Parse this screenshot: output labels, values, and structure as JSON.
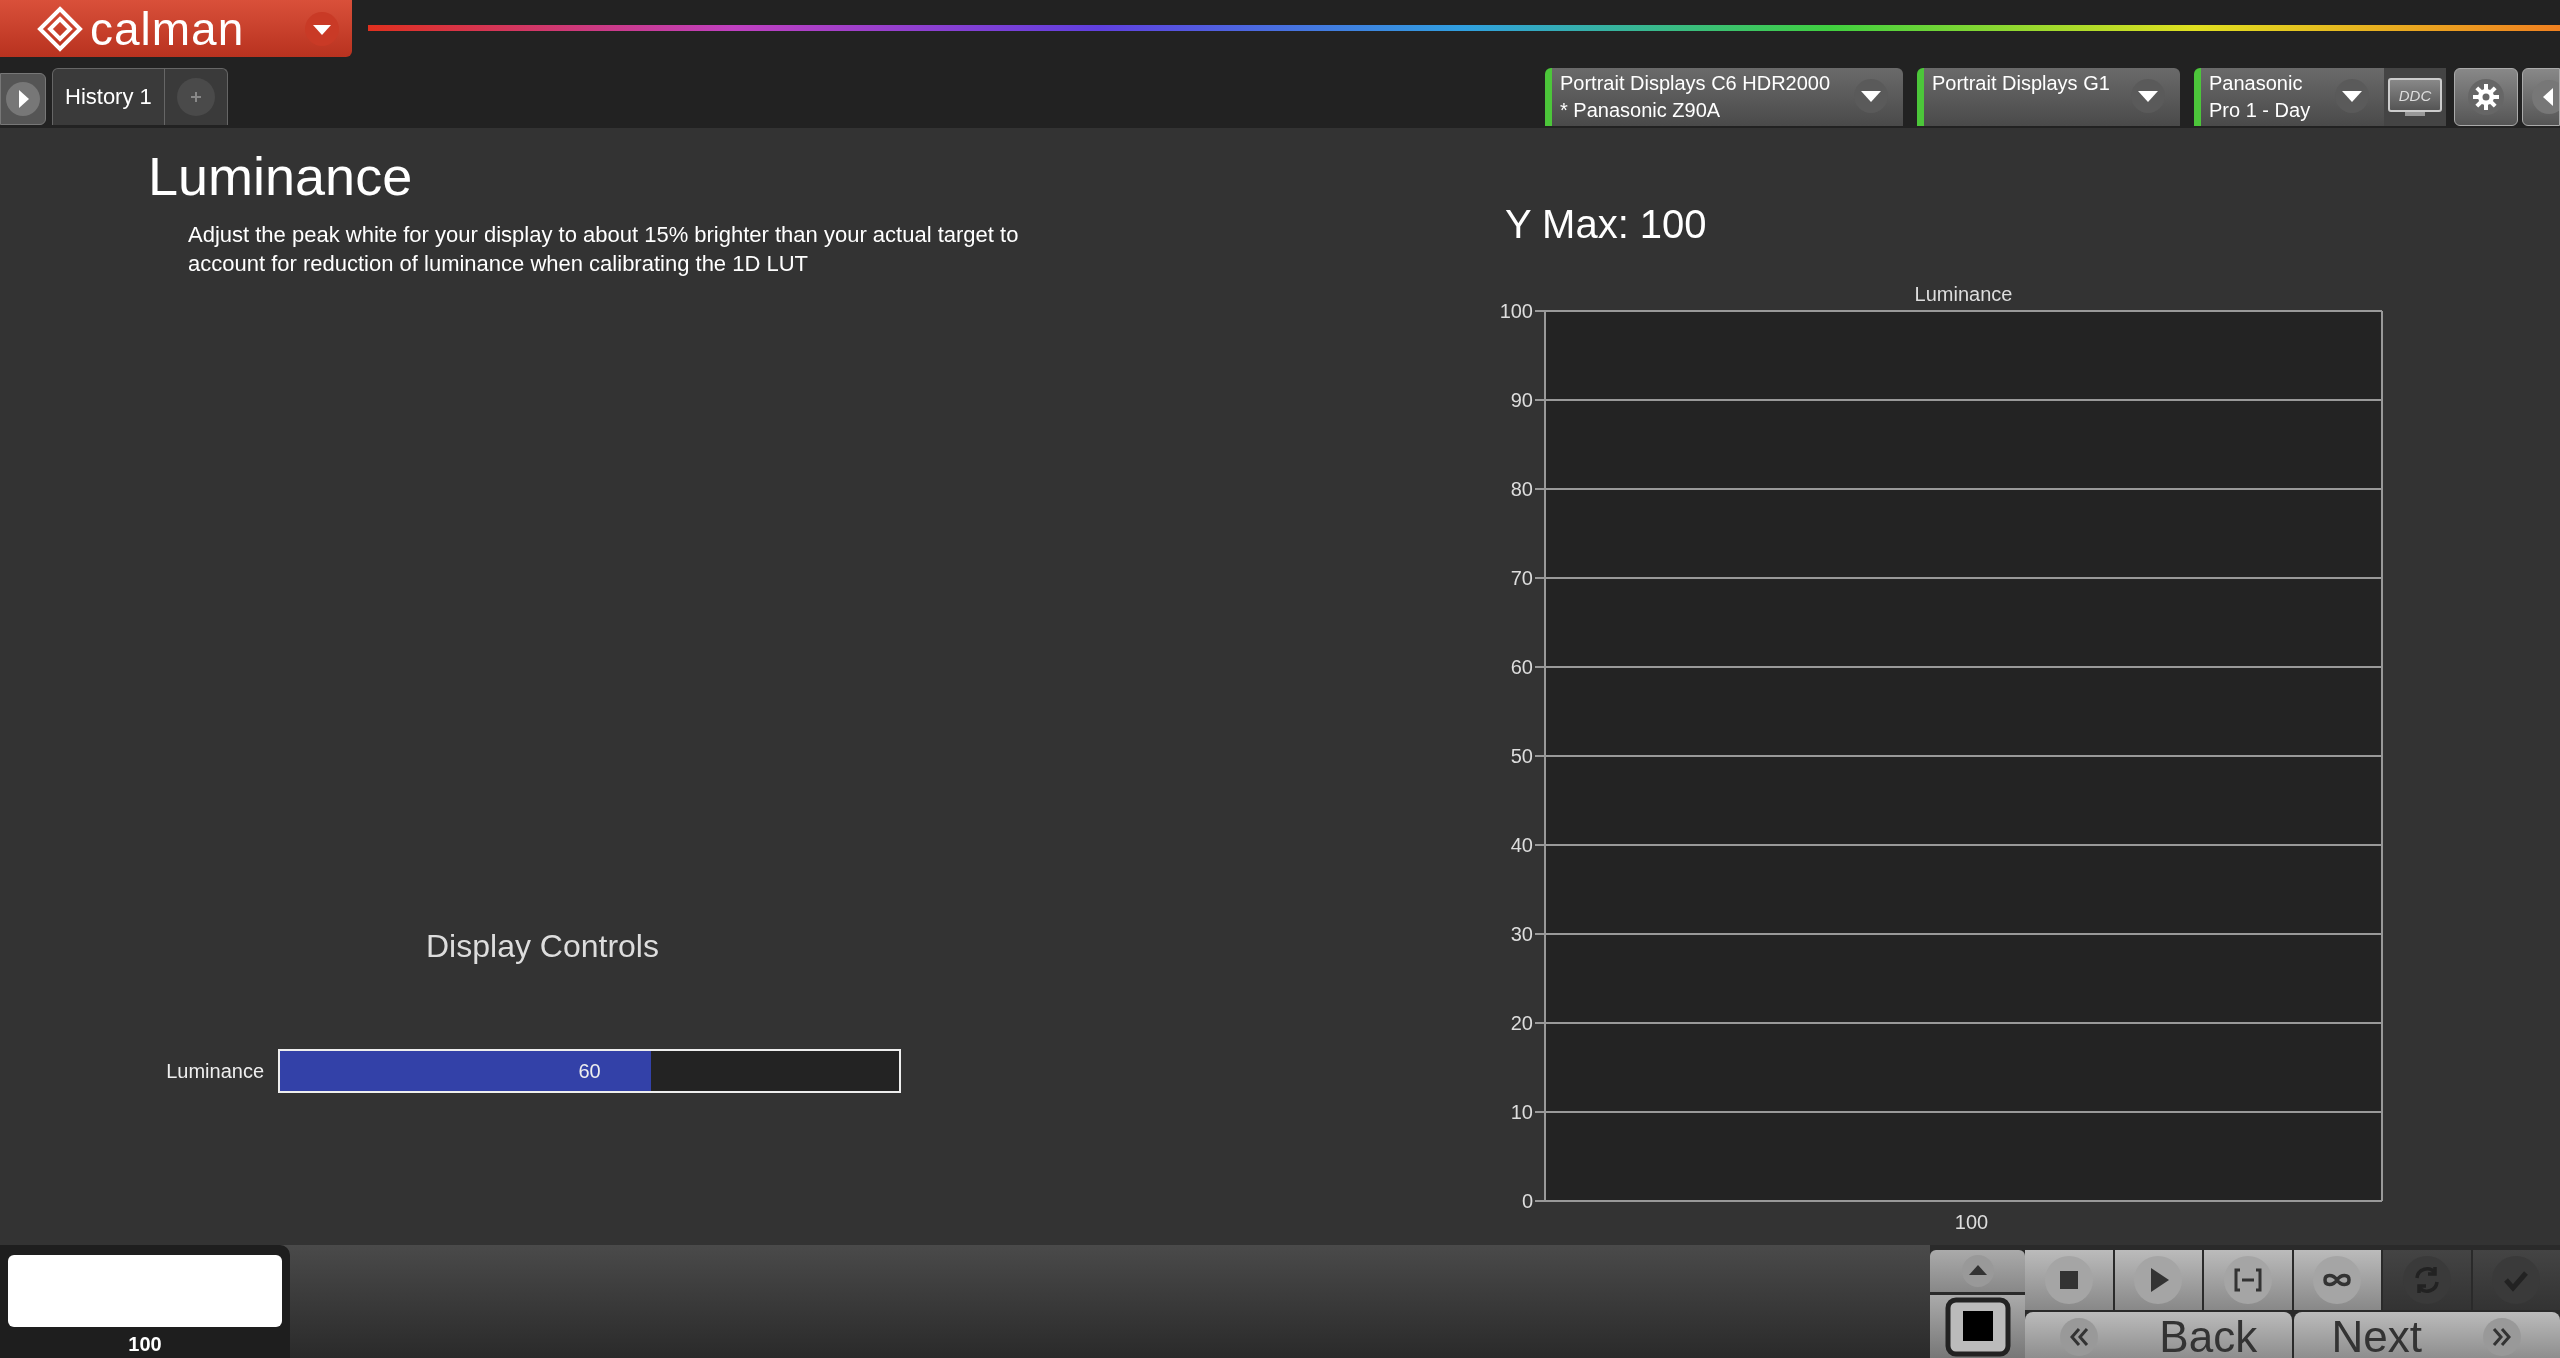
{
  "app": {
    "logo": "calman"
  },
  "tabs": [
    {
      "label": "History 1",
      "selected": true
    }
  ],
  "devices": [
    {
      "lines": [
        "Portrait Displays C6 HDR2000",
        "* Panasonic Z90A"
      ]
    },
    {
      "lines": [
        "Portrait Displays G1"
      ]
    },
    {
      "lines": [
        "Panasonic",
        "Pro 1 - Day"
      ]
    }
  ],
  "ddc": "DDC",
  "page": {
    "title": "Luminance",
    "description": "Adjust the peak white for your display to about 15% brighter than your actual target to account for reduction of luminance when calibrating the 1D LUT",
    "controls_title": "Display Controls",
    "controls": [
      {
        "label": "Luminance",
        "value": "60",
        "level": 0.6
      }
    ]
  },
  "chart": {
    "heading": "Y Max: 100",
    "chart_data": {
      "type": "bar",
      "title": "Luminance",
      "categories": [
        "100"
      ],
      "values": [
        null
      ],
      "grid": true,
      "ylim": [
        0,
        100
      ],
      "yticks": [
        0,
        10,
        20,
        30,
        40,
        50,
        60,
        70,
        80,
        90,
        100
      ]
    }
  },
  "swatch": {
    "label": "100"
  },
  "toolbar": [
    {
      "kind": "stop",
      "disabled": false
    },
    {
      "kind": "play",
      "disabled": false
    },
    {
      "kind": "fit",
      "disabled": false
    },
    {
      "kind": "loop",
      "disabled": false
    },
    {
      "kind": "refresh",
      "disabled": true
    },
    {
      "kind": "check",
      "disabled": true
    }
  ],
  "nav": {
    "back": "Back",
    "next": "Next"
  }
}
